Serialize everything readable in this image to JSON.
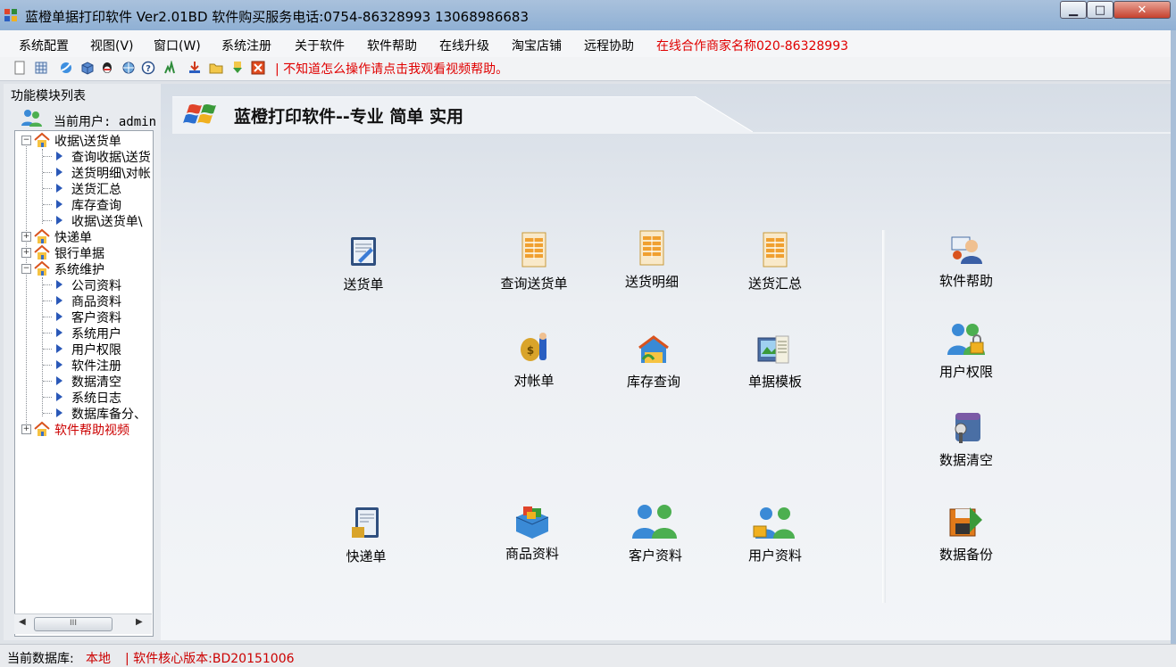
{
  "window": {
    "title": "蓝橙单据打印软件 Ver2.01BD  软件购买服务电话:0754-86328993 13068986683",
    "min_label": "▁",
    "max_label": "□",
    "close_label": "✕"
  },
  "menu": {
    "items": [
      {
        "label": "系统配置"
      },
      {
        "label": "视图(V)"
      },
      {
        "label": "窗口(W)"
      },
      {
        "label": "系统注册"
      },
      {
        "label": "关于软件"
      },
      {
        "label": "软件帮助"
      },
      {
        "label": "在线升级"
      },
      {
        "label": "淘宝店铺"
      },
      {
        "label": "远程协助"
      }
    ],
    "partner": "在线合作商家名称020-86328993",
    "partner_color": "#e00000"
  },
  "toolbar": {
    "icons": [
      "new-icon",
      "table-icon",
      "internet-icon",
      "package-icon",
      "qq-icon",
      "globe-icon",
      "help-icon",
      "search-icon",
      "import-icon",
      "folder-icon",
      "download-icon",
      "exit-icon"
    ],
    "note": "| 不知道怎么操作请点击我观看视频帮助。"
  },
  "left_panel": {
    "title": "功能模块列表",
    "current_user": "当前用户: admin",
    "tree": [
      {
        "label": "收据\\送货单",
        "expanded": true,
        "children": [
          "查询收据\\送货",
          "送货明细\\对帐",
          "送货汇总",
          "库存查询",
          "收据\\送货单\\"
        ]
      },
      {
        "label": "快递单",
        "expanded": false
      },
      {
        "label": "银行单据",
        "expanded": false
      },
      {
        "label": "系统维护",
        "expanded": true,
        "children": [
          "公司资料",
          "商品资料",
          "客户资料",
          "系统用户",
          "用户权限",
          "软件注册",
          "数据清空",
          "系统日志",
          "数据库备分、"
        ]
      },
      {
        "label": "软件帮助视频",
        "expanded": false,
        "color": "#cc0000"
      }
    ],
    "scroll_label": "III"
  },
  "main": {
    "banner": "蓝橙打印软件--专业 简单 实用",
    "modules": [
      {
        "label": "送货单",
        "icon": "delivery-note-icon"
      },
      {
        "label": "查询送货单",
        "icon": "query-delivery-icon"
      },
      {
        "label": "送货明细",
        "icon": "delivery-detail-icon"
      },
      {
        "label": "送货汇总",
        "icon": "delivery-summary-icon"
      },
      {
        "label": "对帐单",
        "icon": "statement-icon"
      },
      {
        "label": "库存查询",
        "icon": "inventory-icon"
      },
      {
        "label": "单据模板",
        "icon": "template-icon"
      },
      {
        "label": "快递单",
        "icon": "express-icon"
      },
      {
        "label": "商品资料",
        "icon": "goods-icon"
      },
      {
        "label": "客户资料",
        "icon": "customers-icon"
      },
      {
        "label": "用户资料",
        "icon": "user-data-icon"
      }
    ],
    "side_modules": [
      {
        "label": "软件帮助",
        "icon": "help-user-icon"
      },
      {
        "label": "用户权限",
        "icon": "user-permission-icon"
      },
      {
        "label": "数据清空",
        "icon": "clear-data-icon"
      },
      {
        "label": "数据备份",
        "icon": "backup-icon"
      }
    ]
  },
  "status": {
    "db_label": "当前数据库:",
    "db_value": "本地",
    "version": "| 软件核心版本:BD20151006",
    "accent": "#cc0000"
  }
}
